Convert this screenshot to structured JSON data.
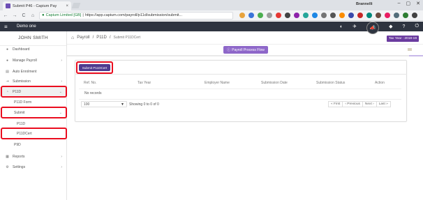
{
  "browser": {
    "tab_title": "Submit P46 - Capium Pay",
    "tab_close": "×",
    "profile_name": "Brannelli",
    "minimize": "–",
    "maximize": "▢",
    "close": "✕",
    "back": "←",
    "forward": "→",
    "reload": "C",
    "home": "⌂",
    "lock_icon": "🔒",
    "secure_label": "Capium Limited [GB]",
    "url": "https://app.capium.com/payroll/p11d/submission/submit..."
  },
  "header": {
    "menu_icon": "≡",
    "company": "Demo one",
    "icons": [
      "◐",
      "✈",
      "📣",
      "◆",
      "?",
      "⏻"
    ]
  },
  "sidebar": {
    "user_name": "JOHN SMITH",
    "items": [
      {
        "label": "Dashboard",
        "icon": "●",
        "chevron": ""
      },
      {
        "label": "Manage Payroll",
        "icon": "●",
        "chevron": "›"
      },
      {
        "label": "Auto Enrolment",
        "icon": "▤",
        "chevron": ""
      },
      {
        "label": "Submission",
        "icon": "⇥",
        "chevron": "›"
      },
      {
        "label": "P11D",
        "icon": "◔",
        "chevron": "⌄"
      },
      {
        "label": "P11D Form",
        "icon": "",
        "chevron": ""
      },
      {
        "label": "Submit",
        "icon": "",
        "chevron": "⌄"
      },
      {
        "label": "P11D",
        "icon": "",
        "chevron": ""
      },
      {
        "label": "P11DCert",
        "icon": "",
        "chevron": ""
      },
      {
        "label": "P9D",
        "icon": "",
        "chevron": ""
      },
      {
        "label": "Reports",
        "icon": "▦",
        "chevron": "›"
      },
      {
        "label": "Settings",
        "icon": "⚙",
        "chevron": "›"
      }
    ]
  },
  "breadcrumb": {
    "home_icon": "⌂",
    "root": "Payroll",
    "sep": "/",
    "level1": "P11D",
    "level2": "Submit P11DCert"
  },
  "tax_year": "Tax Year : 2018-19",
  "process_flow": {
    "icon": "ⓘ",
    "label": "Payroll Process Flow"
  },
  "submit_button": "Submit P11DCert",
  "grid": {
    "columns": [
      "Ref. No.",
      "Tax Year",
      "Employer Name",
      "Submission Date",
      "Submission Status",
      "Action"
    ],
    "empty_text": "No records",
    "page_size": "100",
    "showing": "Showing 0 to 0 of 0",
    "pager": [
      "« First",
      "‹ Previous",
      "Next ›",
      "Last »"
    ]
  },
  "colors": {
    "header_bg": "#2e3440",
    "accent_purple": "#4f3a8f",
    "highlight_red": "#ea0d1f"
  }
}
